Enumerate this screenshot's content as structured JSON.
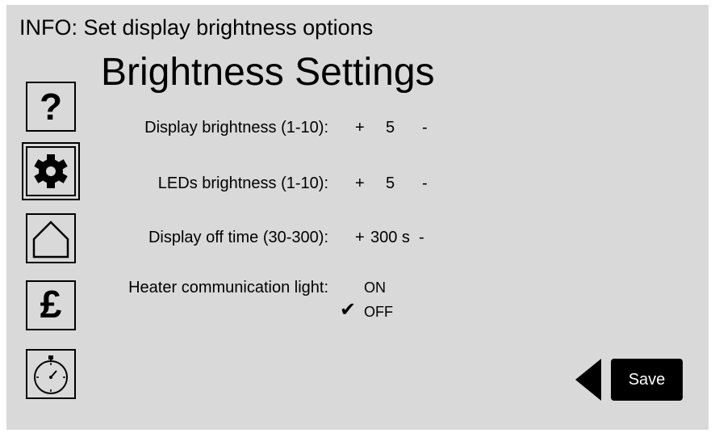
{
  "info": "INFO: Set display brightness options",
  "title": "Brightness Settings",
  "nav": {
    "help_glyph": "?",
    "pound_glyph": "£",
    "icons": [
      "question-icon",
      "gear-icon",
      "home-icon",
      "pound-icon",
      "stopwatch-icon"
    ],
    "active": "gear-icon"
  },
  "settings": [
    {
      "label": "Display brightness (1-10):",
      "plus": "+",
      "value": "5",
      "minus": "-"
    },
    {
      "label": "LEDs brightness (1-10):",
      "plus": "+",
      "value": "5",
      "minus": "-"
    },
    {
      "label": "Display off time (30-300):",
      "plus": "+",
      "value": "300 s",
      "minus": "-"
    }
  ],
  "heater": {
    "label": "Heater communication light:",
    "options": [
      "ON",
      "OFF"
    ],
    "selected": "OFF",
    "check": "✔"
  },
  "save_label": "Save",
  "colors": {
    "background": "#d9d9d9",
    "foreground": "#000000",
    "button_text": "#ffffff"
  }
}
